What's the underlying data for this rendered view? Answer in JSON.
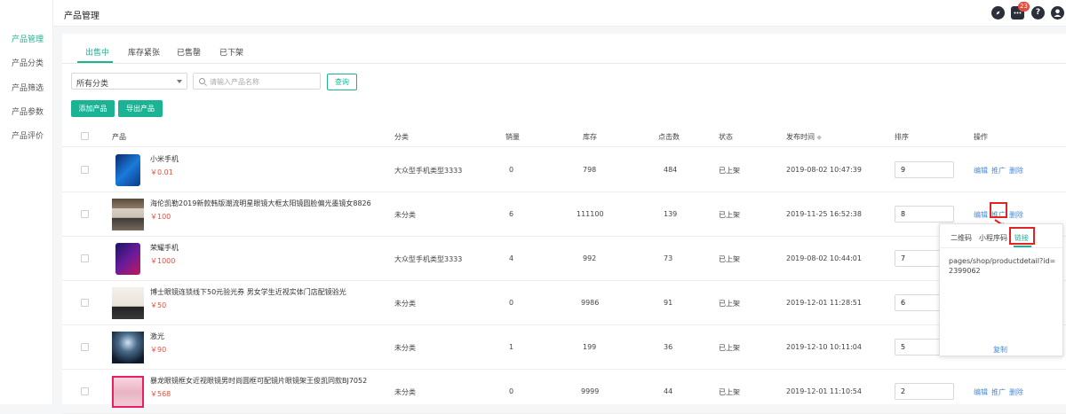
{
  "sidebar": {
    "items": [
      {
        "label": "产品管理",
        "active": true
      },
      {
        "label": "产品分类",
        "active": false
      },
      {
        "label": "产品筛选",
        "active": false
      },
      {
        "label": "产品参数",
        "active": false
      },
      {
        "label": "产品评价",
        "active": false
      }
    ]
  },
  "header": {
    "title": "产品管理",
    "notification_count": "23",
    "icons": [
      "compass-icon",
      "message-icon",
      "help-icon",
      "user-icon"
    ]
  },
  "tabs": [
    {
      "label": "出售中",
      "active": true
    },
    {
      "label": "库存紧张",
      "active": false
    },
    {
      "label": "已售罄",
      "active": false
    },
    {
      "label": "已下架",
      "active": false
    }
  ],
  "filters": {
    "category_value": "所有分类",
    "search_placeholder": "请输入产品名称",
    "search_button": "查询"
  },
  "actions": {
    "add": "添加产品",
    "export": "导出产品"
  },
  "table": {
    "headers": {
      "product": "产品",
      "category": "分类",
      "sales": "销量",
      "stock": "库存",
      "clicks": "点击数",
      "status": "状态",
      "publish_time": "发布时间",
      "sort_mark": "◆",
      "order": "排序",
      "ops": "操作"
    },
    "rows": [
      {
        "name": "小米手机",
        "price": "￥0.01",
        "category": "大众型手机类型3333",
        "sales": "0",
        "stock": "798",
        "clicks": "484",
        "status": "已上架",
        "time": "2019-08-02 10:47:39",
        "order": "9"
      },
      {
        "name": "海伦凯勒2019新款韩版潮流明星眼镜大框太阳镜圆脸偏光墨镜女8826",
        "price": "￥100",
        "category": "未分类",
        "sales": "6",
        "stock": "111100",
        "clicks": "139",
        "status": "已上架",
        "time": "2019-11-25 16:52:38",
        "order": "8"
      },
      {
        "name": "荣耀手机",
        "price": "￥1000",
        "category": "大众型手机类型3333",
        "sales": "4",
        "stock": "992",
        "clicks": "73",
        "status": "已上架",
        "time": "2019-08-02 10:44:01",
        "order": "7"
      },
      {
        "name": "博士眼镜连锁线下50元验光券 男女学生近视实体门店配镜验光",
        "price": "￥50",
        "category": "未分类",
        "sales": "0",
        "stock": "9986",
        "clicks": "91",
        "status": "已上架",
        "time": "2019-12-01 11:28:51",
        "order": "6"
      },
      {
        "name": "激光",
        "price": "￥90",
        "category": "未分类",
        "sales": "1",
        "stock": "199",
        "clicks": "36",
        "status": "已上架",
        "time": "2019-12-10 10:11:04",
        "order": "5"
      },
      {
        "name": "暴龙眼镜框女近视眼镜男时尚圆框可配镜片眼镜架王俊凯同款BJ7052",
        "price": "￥568",
        "category": "未分类",
        "sales": "0",
        "stock": "9999",
        "clicks": "44",
        "status": "已上架",
        "time": "2019-12-01 11:10:54",
        "order": "2"
      }
    ],
    "op_labels": {
      "edit": "编辑",
      "promote": "推广",
      "delete": "删除"
    }
  },
  "popover": {
    "tabs": [
      {
        "label": "二维码",
        "active": false
      },
      {
        "label": "小程序码",
        "active": false
      },
      {
        "label": "链接",
        "active": true
      }
    ],
    "url": "pages/shop/productdetail?id=2399062",
    "copy": "复制"
  },
  "colors": {
    "accent": "#1bb394",
    "price": "#e74c3c",
    "link": "#4a8cd6",
    "highlight": "#e02424"
  }
}
